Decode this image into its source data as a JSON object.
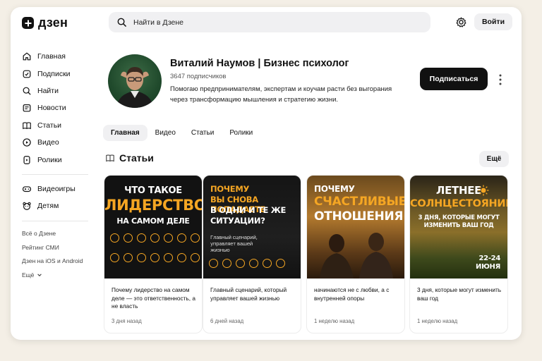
{
  "header": {
    "logo_text": "дзен",
    "search_placeholder": "Найти в Дзене",
    "login_label": "Войти"
  },
  "sidebar": {
    "items": [
      {
        "label": "Главная",
        "icon": "home-icon"
      },
      {
        "label": "Подписки",
        "icon": "subscriptions-icon"
      },
      {
        "label": "Найти",
        "icon": "search-icon"
      },
      {
        "label": "Новости",
        "icon": "news-icon"
      },
      {
        "label": "Статьи",
        "icon": "articles-icon"
      },
      {
        "label": "Видео",
        "icon": "video-icon"
      },
      {
        "label": "Ролики",
        "icon": "shorts-icon"
      }
    ],
    "items2": [
      {
        "label": "Видеоигры",
        "icon": "gamepad-icon"
      },
      {
        "label": "Детям",
        "icon": "kids-icon"
      }
    ],
    "footer": [
      "Всё о Дзене",
      "Рейтинг СМИ",
      "Дзен на iOS и Android",
      "Ещё"
    ]
  },
  "profile": {
    "name": "Виталий Наумов | Бизнес психолог",
    "subscribers": "3647 подписчиков",
    "description": "Помогаю предпринимателям, экспертам и коучам расти без выгорания через трансформацию мышления и стратегию жизни.",
    "subscribe_label": "Подписаться"
  },
  "tabs": [
    "Главная",
    "Видео",
    "Статьи",
    "Ролики"
  ],
  "section": {
    "title": "Статьи",
    "more_label": "Ещё"
  },
  "cards": [
    {
      "headline": [
        "ЧТО ТАКОЕ",
        "ЛИДЕРСТВО",
        "НА САМОМ ДЕЛЕ"
      ],
      "text": "Почему лидерство на самом деле — это ответственность, а не власть",
      "time": "3 дня назад"
    },
    {
      "headline": [
        "ПОЧЕМУ",
        "ВЫ СНОВА ПОПАДАЕТЕ",
        "В ОДНИ И ТЕ ЖЕ",
        "СИТУАЦИИ?"
      ],
      "subline": "Главный сценарий, управляет вашей жизнью",
      "text": "Главный сценарий, который управляет вашей жизнью",
      "time": "6 дней назад"
    },
    {
      "headline": [
        "ПОЧЕМУ",
        "СЧАСТЛИВЫЕ",
        "ОТНОШЕНИЯ"
      ],
      "text": "начинаются не с любви, а с внутренней опоры",
      "time": "1 неделю назад"
    },
    {
      "headline": [
        "ЛЕТНЕЕ",
        "СОЛНЦЕСТОЯНИЕ"
      ],
      "subline": [
        "3 ДНЯ, КОТОРЫЕ МОГУТ",
        "ИЗМЕНИТЬ ВАШ ГОД"
      ],
      "badge": [
        "22-24",
        "ИЮНЯ"
      ],
      "text": "3 дня, которые могут изменить ваш год",
      "time": "1 неделю назад"
    }
  ],
  "colors": {
    "accent_black": "#111111",
    "headline_orange": "#f5a623",
    "page_bg": "#f4efe6"
  }
}
